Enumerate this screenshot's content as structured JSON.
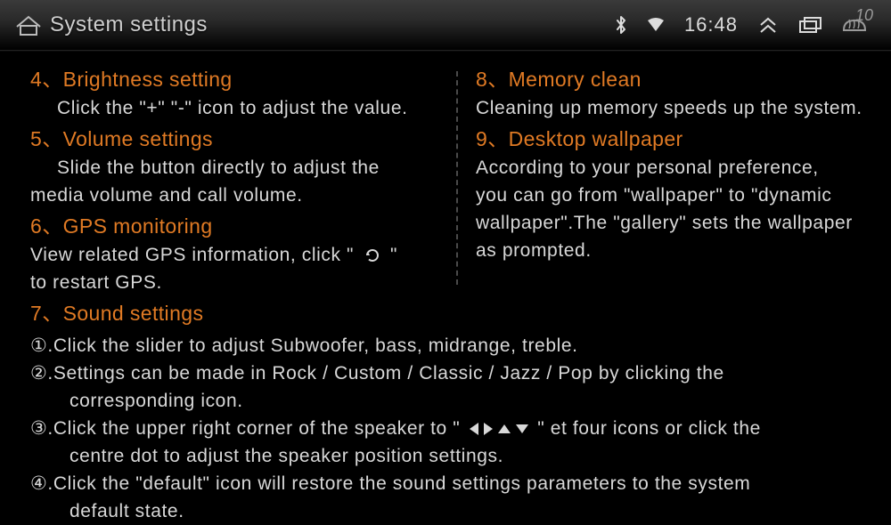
{
  "topbar": {
    "title": "System settings",
    "clock": "16:48",
    "badge": "10"
  },
  "left": {
    "s4": {
      "heading": "4、Brightness setting",
      "desc": "Click the \"+\" \"-\" icon to adjust the value."
    },
    "s5": {
      "heading": "5、Volume settings",
      "desc1": "Slide the button directly to adjust the",
      "desc2": "media volume and call volume."
    },
    "s6": {
      "heading": "6、GPS monitoring",
      "desc1a": "View related GPS information, click \"",
      "desc1b": "\"",
      "desc2": "to restart GPS."
    },
    "s7": {
      "heading": "7、Sound settings"
    }
  },
  "right": {
    "s8": {
      "heading": "8、Memory clean",
      "desc": "Cleaning up memory speeds up the system."
    },
    "s9": {
      "heading": "9、Desktop wallpaper",
      "desc1": "According to your personal preference,",
      "desc2": "you can go from \"wallpaper\" to \"dynamic",
      "desc3": "wallpaper\".The \"gallery\" sets the wallpaper",
      "desc4": "as prompted."
    }
  },
  "sound": {
    "l1": "①.Click the slider to adjust Subwoofer, bass, midrange, treble.",
    "l2a": "②.Settings can be made in Rock / Custom / Classic / Jazz / Pop by clicking the",
    "l2b": "corresponding icon.",
    "l3a": "③.Click the upper right corner of the speaker to \"",
    "l3b": "\" et four icons or click the",
    "l3c": "centre dot to adjust the speaker position settings.",
    "l4a": "④.Click the \"default\" icon will restore the sound settings parameters to the system",
    "l4b": "default state."
  }
}
